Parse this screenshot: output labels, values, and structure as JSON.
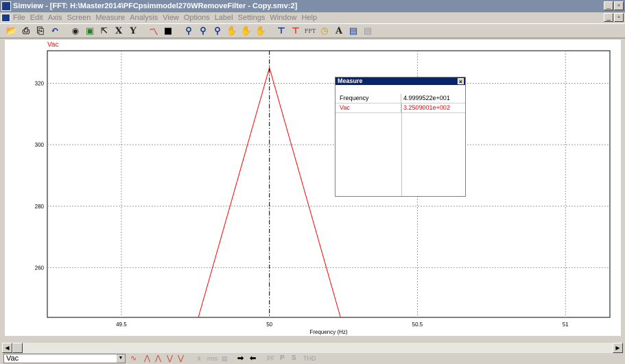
{
  "window": {
    "title": "Simview - [FFT: H:\\Master2014\\PFCpsimmodel270WRemoveFilter - Copy.smv:2]"
  },
  "menu": [
    "File",
    "Edit",
    "Axis",
    "Screen",
    "Measure",
    "Analysis",
    "View",
    "Options",
    "Label",
    "Settings",
    "Window",
    "Help"
  ],
  "toolbar": {
    "x_label": "X",
    "y_label": "Y",
    "fft_label": "FFT",
    "text_label": "A"
  },
  "chart_data": {
    "type": "line",
    "xlabel": "Frequency (Hz)",
    "ylabel": "",
    "xlim": [
      49.25,
      51.15
    ],
    "ylim": [
      243.8,
      330.6
    ],
    "xticks": [
      "49.5",
      "50",
      "50.5",
      "51"
    ],
    "yticks": [
      "260",
      "280",
      "300",
      "320"
    ],
    "grid": true,
    "series": [
      {
        "name": "Vac",
        "color": "#ff0000",
        "x": [
          49.76,
          50.0,
          50.24
        ],
        "y": [
          243.8,
          325.09,
          243.8
        ]
      }
    ],
    "cursor": {
      "x": 50.0
    }
  },
  "measure": {
    "title": "Measure",
    "rows": [
      {
        "label": "Frequency",
        "value": "4.9999522e+001",
        "color": "#000000"
      },
      {
        "label": "Vac",
        "value": "3.2509001e+002",
        "color": "#ff0000"
      }
    ]
  },
  "bottom": {
    "selected_variable": "Vac",
    "tools": {
      "avg": "x̄",
      "rms": "rms",
      "pf": "PF",
      "p": "P",
      "s": "S",
      "thd": "THD"
    }
  }
}
